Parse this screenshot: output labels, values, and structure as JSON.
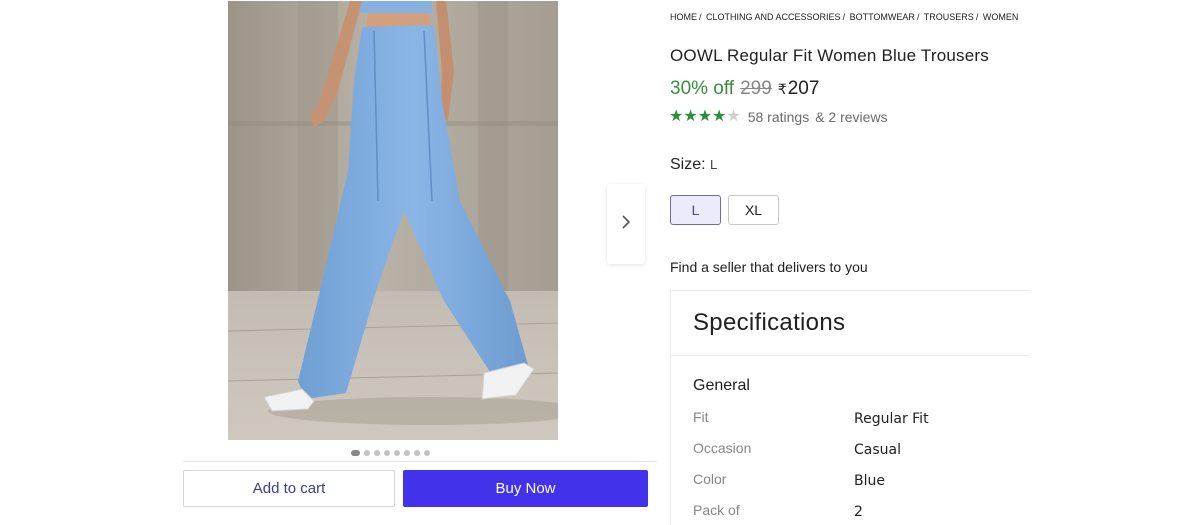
{
  "breadcrumb": [
    "HOME",
    "CLOTHING AND ACCESSORIES",
    "BOTTOMWEAR",
    "TROUSERS",
    "WOMEN'S"
  ],
  "product": {
    "title": "OOWL Regular Fit Women Blue Trousers",
    "discount": "30% off",
    "mrp": "299",
    "currency": "₹",
    "price": "207",
    "rating": 4,
    "rating_max": 5,
    "ratings_text": "58 ratings",
    "reviews_text": "& 2 reviews"
  },
  "size": {
    "label": "Size:",
    "selected": "L",
    "options": [
      "L",
      "XL"
    ]
  },
  "seller_text": "Find a seller that delivers to you",
  "specifications": {
    "title": "Specifications",
    "group": "General",
    "rows": [
      {
        "key": "Fit",
        "value": "Regular Fit"
      },
      {
        "key": "Occasion",
        "value": "Casual"
      },
      {
        "key": "Color",
        "value": "Blue"
      },
      {
        "key": "Pack of",
        "value": "2"
      }
    ]
  },
  "gallery": {
    "image_count": 8,
    "active_index": 0
  },
  "actions": {
    "add_to_cart": "Add to cart",
    "buy_now": "Buy Now"
  },
  "colors": {
    "accent": "#4232ec",
    "discount": "#388e3c",
    "star": "#2c8d3c",
    "trouser": "#8ab6e6"
  },
  "icons": {
    "next": "chevron-right-icon",
    "star": "star-icon"
  }
}
